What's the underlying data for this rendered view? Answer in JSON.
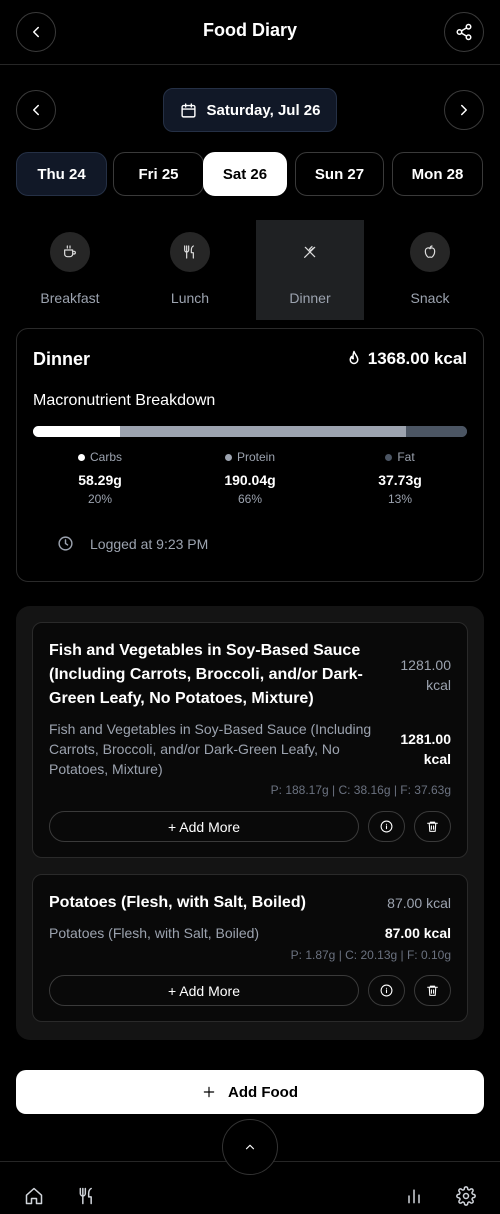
{
  "header": {
    "title": "Food Diary",
    "back_icon": "chevron-left-icon",
    "share_icon": "share-icon"
  },
  "date_nav": {
    "selected_date": "Saturday, Jul 26"
  },
  "days": [
    {
      "label": "Thu 24",
      "state": "past"
    },
    {
      "label": "Fri 25",
      "state": "normal"
    },
    {
      "label": "Sat 26",
      "state": "selected"
    },
    {
      "label": "Sun 27",
      "state": "normal"
    },
    {
      "label": "Mon 28",
      "state": "normal"
    }
  ],
  "meals": [
    {
      "label": "Breakfast",
      "icon": "coffee-icon"
    },
    {
      "label": "Lunch",
      "icon": "utensils-icon"
    },
    {
      "label": "Dinner",
      "icon": "utensils-crossed-icon",
      "active": true
    },
    {
      "label": "Snack",
      "icon": "apple-icon"
    }
  ],
  "summary": {
    "title": "Dinner",
    "kcal": "1368.00 kcal",
    "macro_title": "Macronutrient Breakdown",
    "macros": [
      {
        "name": "Carbs",
        "grams": "58.29g",
        "percent": "20%",
        "fraction": 0.2,
        "color": "#ffffff"
      },
      {
        "name": "Protein",
        "grams": "190.04g",
        "percent": "66%",
        "fraction": 0.66,
        "color": "#9ca3af"
      },
      {
        "name": "Fat",
        "grams": "37.73g",
        "percent": "13%",
        "fraction": 0.14,
        "color": "#4b5563"
      }
    ],
    "logged": "Logged at 9:23 PM"
  },
  "foods": [
    {
      "name": "Fish and Vegetables in Soy-Based Sauce (Including Carrots, Broccoli, and/or Dark-Green Leafy, No Potatoes, Mixture)",
      "kcal_top": "1281.00 kcal",
      "description": "Fish and Vegetables in Soy-Based Sauce (Including Carrots, Broccoli, and/or Dark-Green Leafy, No Potatoes, Mixture)",
      "kcal": "1281.00 kcal",
      "macros": "P: 188.17g | C: 38.16g | F: 37.63g",
      "add_more": "+ Add More"
    },
    {
      "name": "Potatoes (Flesh, with Salt, Boiled)",
      "kcal_top": "87.00 kcal",
      "description": "Potatoes (Flesh, with Salt, Boiled)",
      "kcal": "87.00 kcal",
      "macros": "P: 1.87g | C: 20.13g | F: 0.10g",
      "add_more": "+ Add More"
    }
  ],
  "add_food_label": "Add Food",
  "bottom_nav": [
    "home-icon",
    "utensils-icon",
    "bar-chart-icon",
    "settings-icon"
  ]
}
